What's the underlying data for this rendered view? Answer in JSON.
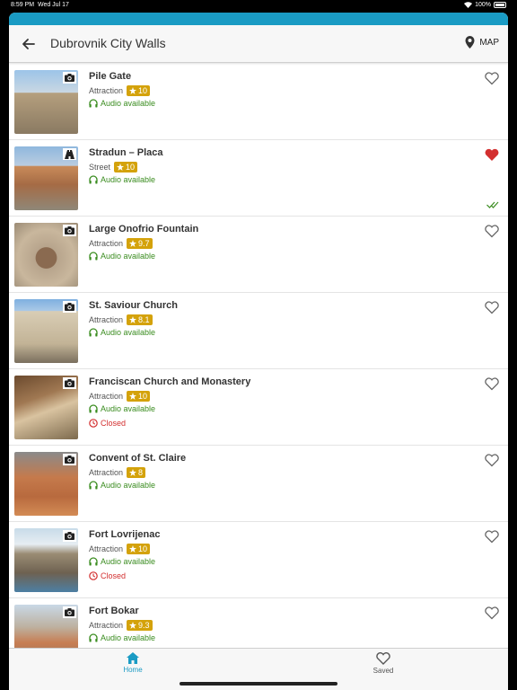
{
  "status": {
    "time": "8:59 PM",
    "date": "Wed Jul 17",
    "battery": "100%"
  },
  "header": {
    "title": "Dubrovnik City Walls",
    "map_label": "MAP"
  },
  "colors": {
    "accent": "#1a9bc4",
    "rating": "#d4a20a",
    "audio": "#3a8c1f",
    "closed": "#d32f2f",
    "heart_filled": "#d32f2f"
  },
  "items": [
    {
      "name": "Pile Gate",
      "type": "Attraction",
      "rating": "10",
      "audio": "Audio available",
      "closed": "",
      "favorite": false,
      "icon": "camera-icon"
    },
    {
      "name": "Stradun – Placa",
      "type": "Street",
      "rating": "10",
      "audio": "Audio available",
      "closed": "",
      "favorite": true,
      "icon": "road-icon"
    },
    {
      "name": "Large Onofrio Fountain",
      "type": "Attraction",
      "rating": "9.7",
      "audio": "Audio available",
      "closed": "",
      "favorite": false,
      "icon": "camera-icon"
    },
    {
      "name": "St. Saviour Church",
      "type": "Attraction",
      "rating": "8.1",
      "audio": "Audio available",
      "closed": "",
      "favorite": false,
      "icon": "camera-icon"
    },
    {
      "name": "Franciscan Church and Monastery",
      "type": "Attraction",
      "rating": "10",
      "audio": "Audio available",
      "closed": "Closed",
      "favorite": false,
      "icon": "camera-icon"
    },
    {
      "name": "Convent of St. Claire",
      "type": "Attraction",
      "rating": "8",
      "audio": "Audio available",
      "closed": "",
      "favorite": false,
      "icon": "camera-icon"
    },
    {
      "name": "Fort Lovrijenac",
      "type": "Attraction",
      "rating": "10",
      "audio": "Audio available",
      "closed": "Closed",
      "favorite": false,
      "icon": "camera-icon"
    },
    {
      "name": "Fort Bokar",
      "type": "Attraction",
      "rating": "9.3",
      "audio": "Audio available",
      "closed": "",
      "favorite": false,
      "icon": "camera-icon"
    }
  ],
  "tabs": {
    "home": "Home",
    "saved": "Saved"
  }
}
